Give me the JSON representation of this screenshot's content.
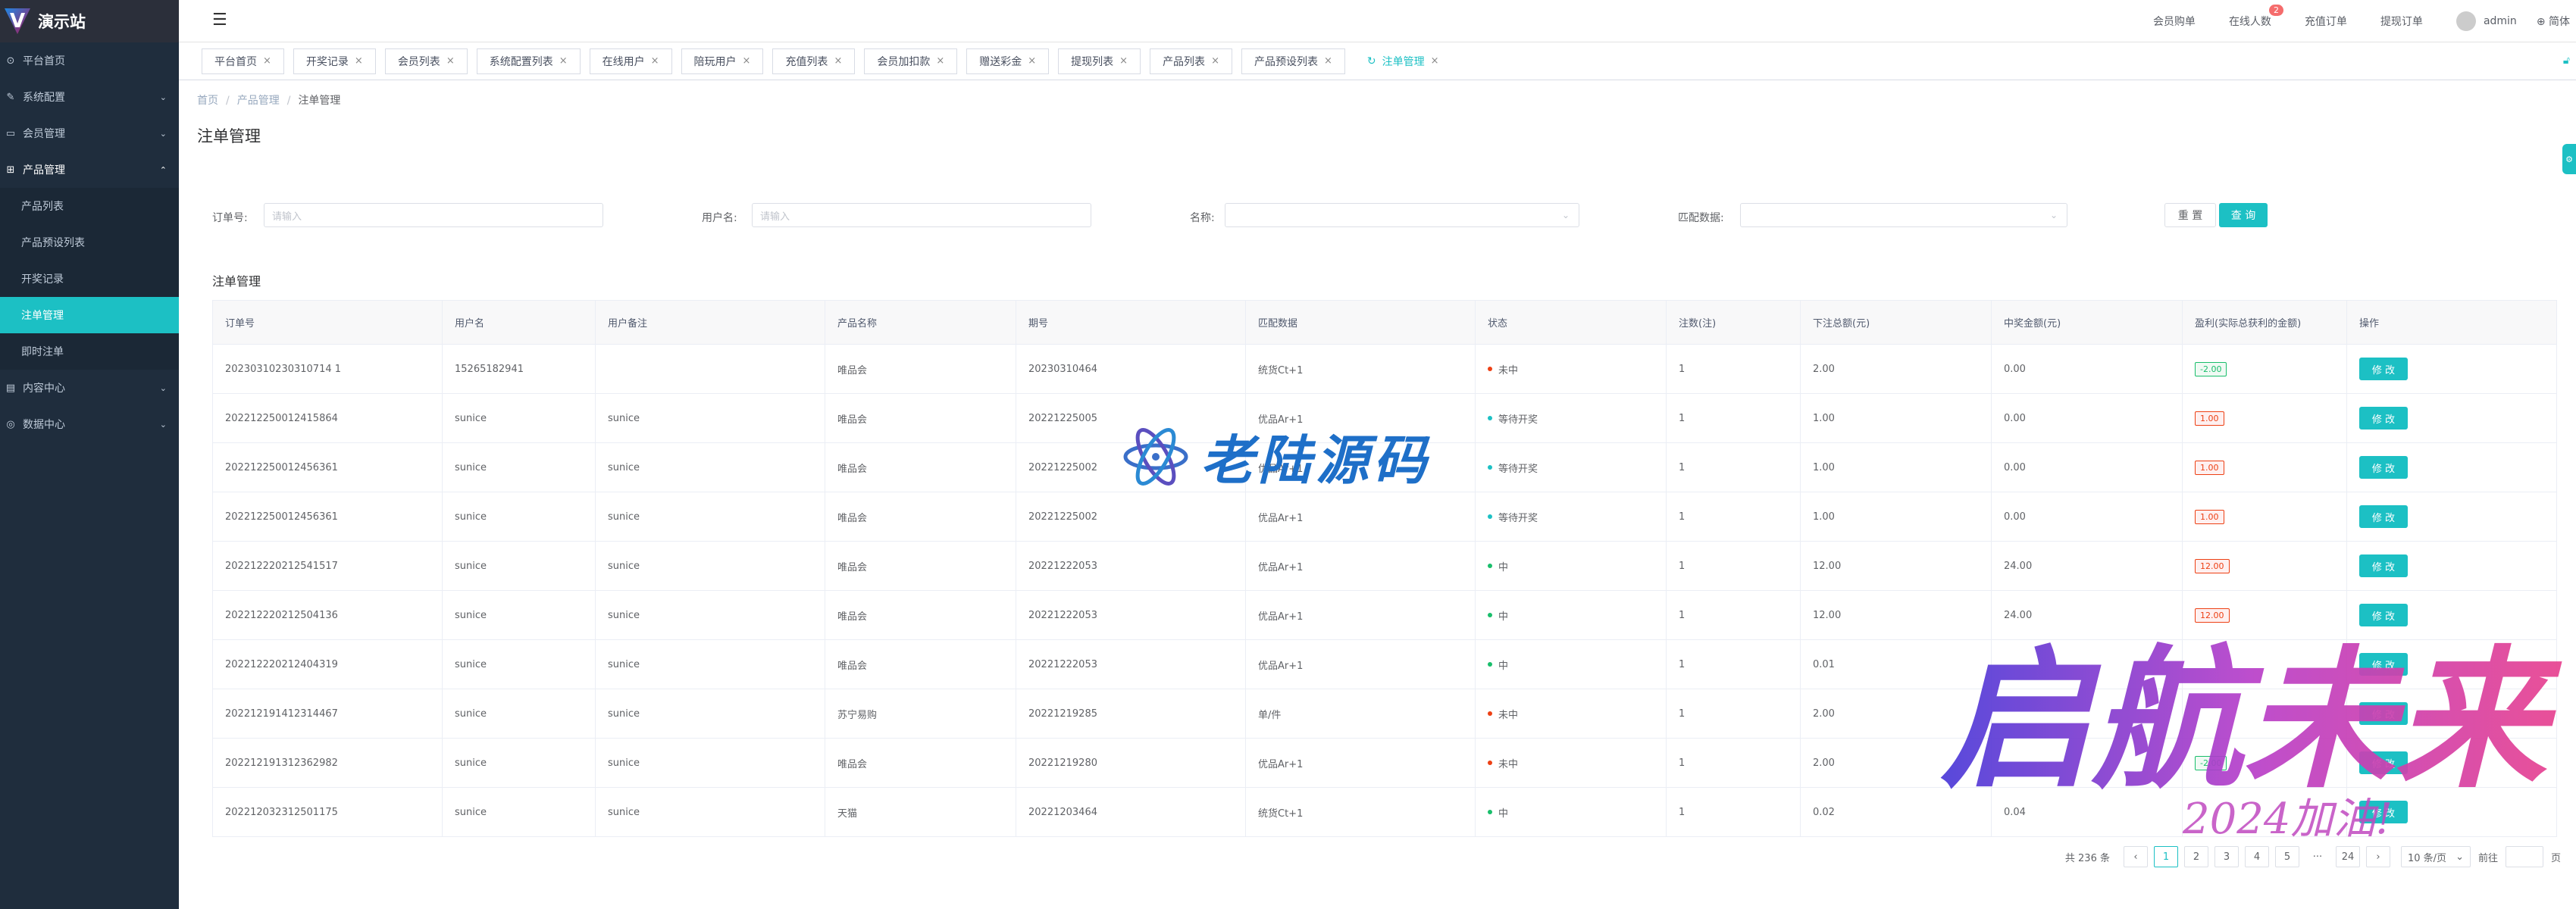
{
  "app": {
    "title": "演示站",
    "logo_letter": "V"
  },
  "sidebar": {
    "items": [
      {
        "label": "平台首页",
        "icon": "home-icon"
      },
      {
        "label": "系统配置",
        "icon": "edit-icon",
        "expandable": true
      },
      {
        "label": "会员管理",
        "icon": "chat-icon",
        "expandable": true
      },
      {
        "label": "产品管理",
        "icon": "grid-icon",
        "expandable": true,
        "expanded": true
      },
      {
        "label": "内容中心",
        "icon": "list-icon",
        "expandable": true
      },
      {
        "label": "数据中心",
        "icon": "circle-icon",
        "expandable": true
      }
    ],
    "product_sub": [
      "产品列表",
      "产品预设列表",
      "开奖记录",
      "注单管理",
      "即时注单"
    ],
    "active_sub": "注单管理"
  },
  "header": {
    "links": [
      "会员购单",
      "在线人数",
      "充值订单",
      "提现订单"
    ],
    "online_badge": "2",
    "user": "admin",
    "lang": "简体"
  },
  "tags": [
    {
      "label": "平台首页"
    },
    {
      "label": "开奖记录"
    },
    {
      "label": "会员列表"
    },
    {
      "label": "系统配置列表"
    },
    {
      "label": "在线用户"
    },
    {
      "label": "陪玩用户"
    },
    {
      "label": "充值列表"
    },
    {
      "label": "会员加扣款"
    },
    {
      "label": "赠送彩金"
    },
    {
      "label": "提现列表"
    },
    {
      "label": "产品列表"
    },
    {
      "label": "产品预设列表"
    },
    {
      "label": "注单管理",
      "active": true
    }
  ],
  "breadcrumb": [
    "首页",
    "产品管理",
    "注单管理"
  ],
  "page_title": "注单管理",
  "filters": {
    "order_no": {
      "label": "订单号:",
      "placeholder": "请输入"
    },
    "username": {
      "label": "用户名:",
      "placeholder": "请输入"
    },
    "name": {
      "label": "名称:",
      "placeholder": ""
    },
    "match": {
      "label": "匹配数据:",
      "placeholder": ""
    },
    "reset_label": "重 置",
    "search_label": "查 询"
  },
  "table": {
    "title": "注单管理",
    "columns": [
      "订单号",
      "用户名",
      "用户备注",
      "产品名称",
      "期号",
      "匹配数据",
      "状态",
      "注数(注)",
      "下注总额(元)",
      "中奖金额(元)",
      "盈利(实际总获利的金额)",
      "操作"
    ],
    "rows": [
      {
        "order": "20230310230310714 1",
        "user": "15265182941",
        "note": "",
        "product": "唯品会",
        "period": "20230310464",
        "match": "统货Ct+1",
        "status": "未中",
        "status_color": "#ed4014",
        "count": "1",
        "bet": "2.00",
        "win": "0.00",
        "profit": "-2.00",
        "profit_type": "neg"
      },
      {
        "order": "202212250012415864",
        "user": "sunice",
        "note": "sunice",
        "product": "唯品会",
        "period": "20221225005",
        "match": "优品Ar+1",
        "status": "等待开奖",
        "status_color": "#1cc0c4",
        "count": "1",
        "bet": "1.00",
        "win": "0.00",
        "profit": "1.00",
        "profit_type": "pos"
      },
      {
        "order": "202212250012456361",
        "user": "sunice",
        "note": "sunice",
        "product": "唯品会",
        "period": "20221225002",
        "match": "优品Ar+1",
        "status": "等待开奖",
        "status_color": "#1cc0c4",
        "count": "1",
        "bet": "1.00",
        "win": "0.00",
        "profit": "1.00",
        "profit_type": "pos"
      },
      {
        "order": "202212250012456361",
        "user": "sunice",
        "note": "sunice",
        "product": "唯品会",
        "period": "20221225002",
        "match": "优品Ar+1",
        "status": "等待开奖",
        "status_color": "#1cc0c4",
        "count": "1",
        "bet": "1.00",
        "win": "0.00",
        "profit": "1.00",
        "profit_type": "pos"
      },
      {
        "order": "202212220212541517",
        "user": "sunice",
        "note": "sunice",
        "product": "唯品会",
        "period": "20221222053",
        "match": "优品Ar+1",
        "status": "中",
        "status_color": "#19be6b",
        "count": "1",
        "bet": "12.00",
        "win": "24.00",
        "profit": "12.00",
        "profit_type": "pos"
      },
      {
        "order": "202212220212504136",
        "user": "sunice",
        "note": "sunice",
        "product": "唯品会",
        "period": "20221222053",
        "match": "优品Ar+1",
        "status": "中",
        "status_color": "#19be6b",
        "count": "1",
        "bet": "12.00",
        "win": "24.00",
        "profit": "12.00",
        "profit_type": "pos"
      },
      {
        "order": "202212220212404319",
        "user": "sunice",
        "note": "sunice",
        "product": "唯品会",
        "period": "20221222053",
        "match": "优品Ar+1",
        "status": "中",
        "status_color": "#19be6b",
        "count": "1",
        "bet": "0.01",
        "win": "",
        "profit": "",
        "profit_type": ""
      },
      {
        "order": "202212191412314467",
        "user": "sunice",
        "note": "sunice",
        "product": "苏宁易购",
        "period": "20221219285",
        "match": "单/件",
        "status": "未中",
        "status_color": "#ed4014",
        "count": "1",
        "bet": "2.00",
        "win": "",
        "profit": "",
        "profit_type": ""
      },
      {
        "order": "202212191312362982",
        "user": "sunice",
        "note": "sunice",
        "product": "唯品会",
        "period": "20221219280",
        "match": "优品Ar+1",
        "status": "未中",
        "status_color": "#ed4014",
        "count": "1",
        "bet": "2.00",
        "win": "",
        "profit": "-2.00",
        "profit_type": "neg"
      },
      {
        "order": "202212032312501175",
        "user": "sunice",
        "note": "sunice",
        "product": "天猫",
        "period": "20221203464",
        "match": "统货Ct+1",
        "status": "中",
        "status_color": "#19be6b",
        "count": "1",
        "bet": "0.02",
        "win": "0.04",
        "profit": "",
        "profit_type": ""
      }
    ],
    "edit_label": "修 改"
  },
  "pagination": {
    "total": "共 236 条",
    "pages": [
      "1",
      "2",
      "3",
      "4",
      "5",
      "···",
      "24"
    ],
    "current": "1",
    "size": "10 条/页",
    "goto_label": "前往",
    "page_suffix": "页"
  },
  "watermarks": {
    "center": "老陆源码",
    "corner": "启航未来",
    "corner_sub": "2024加油!"
  },
  "colors": {
    "accent": "#1cc0c4",
    "sidebar": "#1f2d3d",
    "danger": "#ed4014",
    "success": "#19be6b"
  }
}
